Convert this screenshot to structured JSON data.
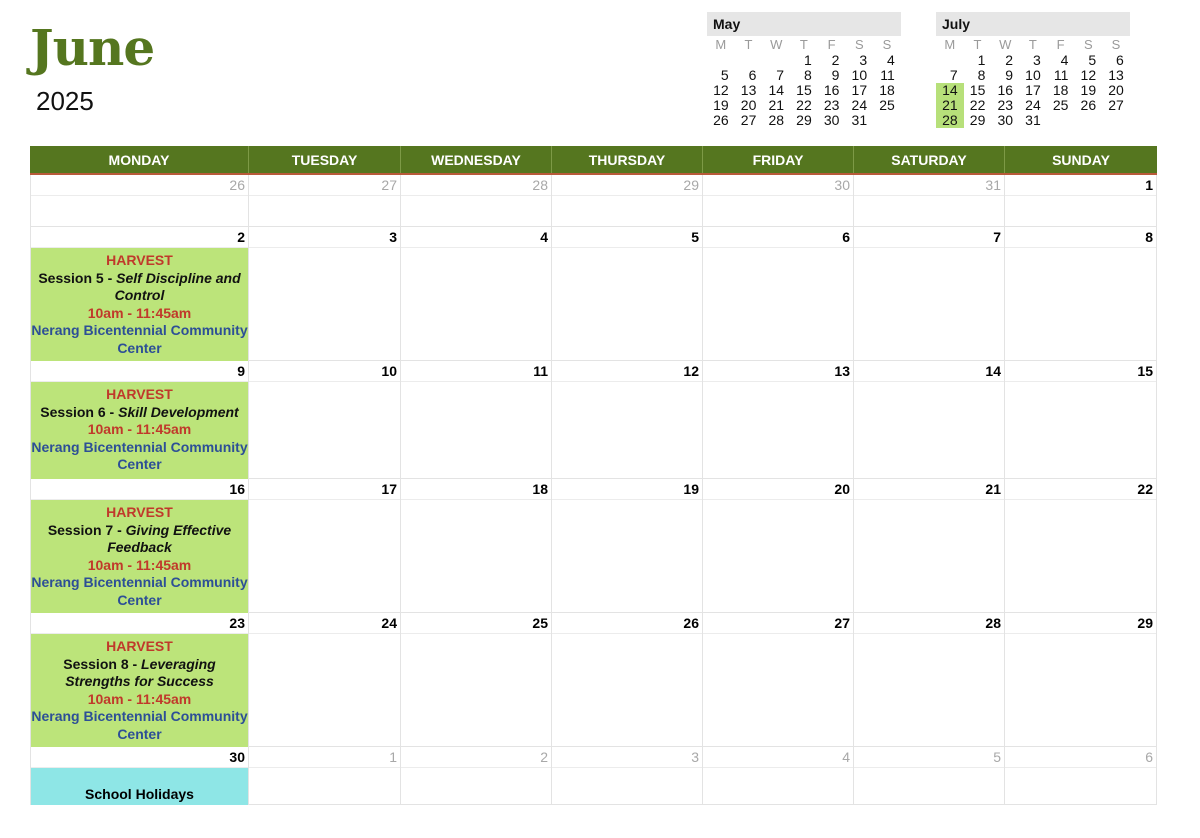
{
  "title": {
    "month": "June",
    "year": "2025"
  },
  "mini_calendars": [
    {
      "name": "May",
      "dow": [
        "M",
        "T",
        "W",
        "T",
        "F",
        "S",
        "S"
      ],
      "weeks": [
        [
          "",
          "",
          "",
          "1",
          "2",
          "3",
          "4"
        ],
        [
          "5",
          "6",
          "7",
          "8",
          "9",
          "10",
          "11"
        ],
        [
          "12",
          "13",
          "14",
          "15",
          "16",
          "17",
          "18"
        ],
        [
          "19",
          "20",
          "21",
          "22",
          "23",
          "24",
          "25"
        ],
        [
          "26",
          "27",
          "28",
          "29",
          "30",
          "31",
          ""
        ]
      ],
      "highlighted": []
    },
    {
      "name": "July",
      "dow": [
        "M",
        "T",
        "W",
        "T",
        "F",
        "S",
        "S"
      ],
      "weeks": [
        [
          "",
          "1",
          "2",
          "3",
          "4",
          "5",
          "6"
        ],
        [
          "7",
          "8",
          "9",
          "10",
          "11",
          "12",
          "13"
        ],
        [
          "14",
          "15",
          "16",
          "17",
          "18",
          "19",
          "20"
        ],
        [
          "21",
          "22",
          "23",
          "24",
          "25",
          "26",
          "27"
        ],
        [
          "28",
          "29",
          "30",
          "31",
          "",
          "",
          ""
        ]
      ],
      "highlighted": [
        "14",
        "21",
        "28"
      ]
    }
  ],
  "weekdays": [
    "MONDAY",
    "TUESDAY",
    "WEDNESDAY",
    "THURSDAY",
    "FRIDAY",
    "SATURDAY",
    "SUNDAY"
  ],
  "weeks": [
    {
      "days": [
        "26",
        "27",
        "28",
        "29",
        "30",
        "31",
        "1"
      ],
      "muted": [
        true,
        true,
        true,
        true,
        true,
        true,
        false
      ],
      "height": 52
    },
    {
      "days": [
        "2",
        "3",
        "4",
        "5",
        "6",
        "7",
        "8"
      ],
      "muted": [
        false,
        false,
        false,
        false,
        false,
        false,
        false
      ],
      "height": 134
    },
    {
      "days": [
        "9",
        "10",
        "11",
        "12",
        "13",
        "14",
        "15"
      ],
      "muted": [
        false,
        false,
        false,
        false,
        false,
        false,
        false
      ],
      "height": 118
    },
    {
      "days": [
        "16",
        "17",
        "18",
        "19",
        "20",
        "21",
        "22"
      ],
      "muted": [
        false,
        false,
        false,
        false,
        false,
        false,
        false
      ],
      "height": 134
    },
    {
      "days": [
        "23",
        "24",
        "25",
        "26",
        "27",
        "28",
        "29"
      ],
      "muted": [
        false,
        false,
        false,
        false,
        false,
        false,
        false
      ],
      "height": 134
    },
    {
      "days": [
        "30",
        "1",
        "2",
        "3",
        "4",
        "5",
        "6"
      ],
      "muted": [
        false,
        true,
        true,
        true,
        true,
        true,
        true
      ],
      "height": 58
    }
  ],
  "events": [
    {
      "week": 1,
      "title": "HARVEST",
      "session_prefix": "Session 5 - ",
      "session_name": "Self Discipline and Control",
      "time": "10am - 11:45am",
      "location": "Nerang Bicentennial Community Center"
    },
    {
      "week": 2,
      "title": "HARVEST",
      "session_prefix": "Session 6 - ",
      "session_name": "Skill Development",
      "time": "10am - 11:45am",
      "location": "Nerang Bicentennial Community Center"
    },
    {
      "week": 3,
      "title": "HARVEST",
      "session_prefix": "Session 7 -  ",
      "session_name": "Giving Effective Feedback",
      "time": "10am - 11:45am",
      "location": "Nerang Bicentennial Community Center"
    },
    {
      "week": 4,
      "title": "HARVEST",
      "session_prefix": "Session 8 - ",
      "session_name": "Leveraging Strengths for Success",
      "time": "10am - 11:45am",
      "location": "Nerang Bicentennial Community Center"
    }
  ],
  "holiday": {
    "week": 5,
    "label": "School Holidays"
  },
  "colors": {
    "header": "#55761f",
    "event": "#bce47a",
    "holiday": "#8ee6e6",
    "accent_red": "#c0392b",
    "location_blue": "#2d4f96"
  }
}
